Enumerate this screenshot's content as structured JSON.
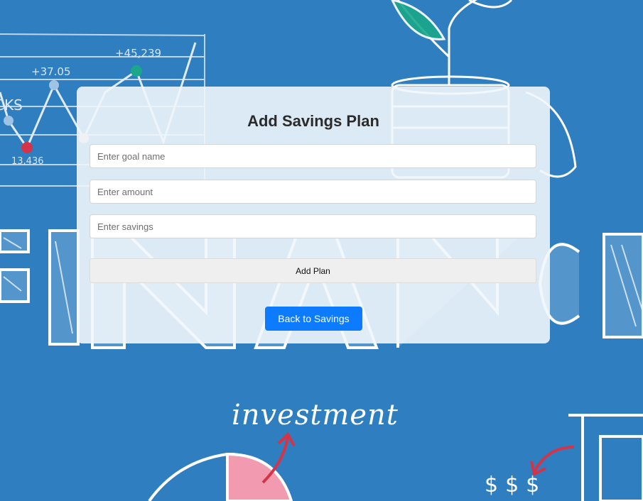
{
  "form": {
    "title": "Add Savings Plan",
    "goal_placeholder": "Enter goal name",
    "amount_placeholder": "Enter amount",
    "savings_placeholder": "Enter savings",
    "add_label": "Add Plan",
    "back_label": "Back to Savings"
  },
  "background": {
    "word_investment": "investment",
    "word_stocks": "CKS",
    "number_top": "+45,239",
    "number_mid": "+37.05",
    "number_low": "13,436",
    "symbols": "$$$",
    "word_finance": "FINANCE",
    "colors": {
      "base": "#2f7ec0",
      "accent_red": "#d3344a",
      "accent_green": "#1aa88a",
      "accent_pink": "#f29bb0"
    }
  }
}
